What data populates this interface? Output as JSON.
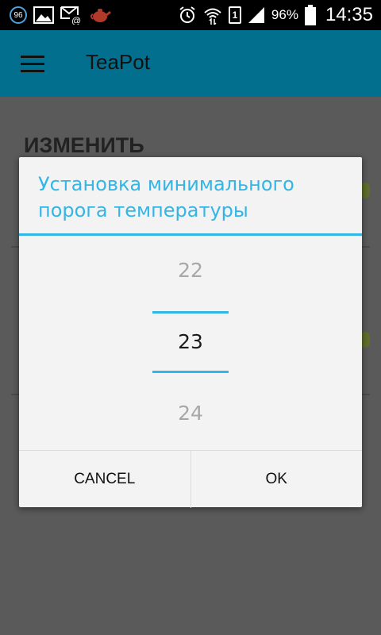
{
  "status_bar": {
    "notification_count": "96",
    "battery_percent": "96%",
    "sim_slot": "1",
    "time": "14:35",
    "icons": [
      "notification-badge-icon",
      "image-icon",
      "mail-icon",
      "teapot-icon",
      "alarm-icon",
      "wifi-icon",
      "signal-icon",
      "battery-icon"
    ]
  },
  "app_bar": {
    "title": "TeaPot",
    "menu_icon": "menu-icon"
  },
  "background": {
    "heading": "ИЗМЕНИТЬ"
  },
  "dialog": {
    "title": "Установка минимального порога температуры",
    "picker": {
      "previous": "22",
      "current": "23",
      "next": "24"
    },
    "buttons": {
      "cancel": "CANCEL",
      "ok": "OK"
    }
  },
  "colors": {
    "accent": "#33b5e5",
    "app_bar": "#036f8e",
    "scrim": "#5a5a5a"
  }
}
